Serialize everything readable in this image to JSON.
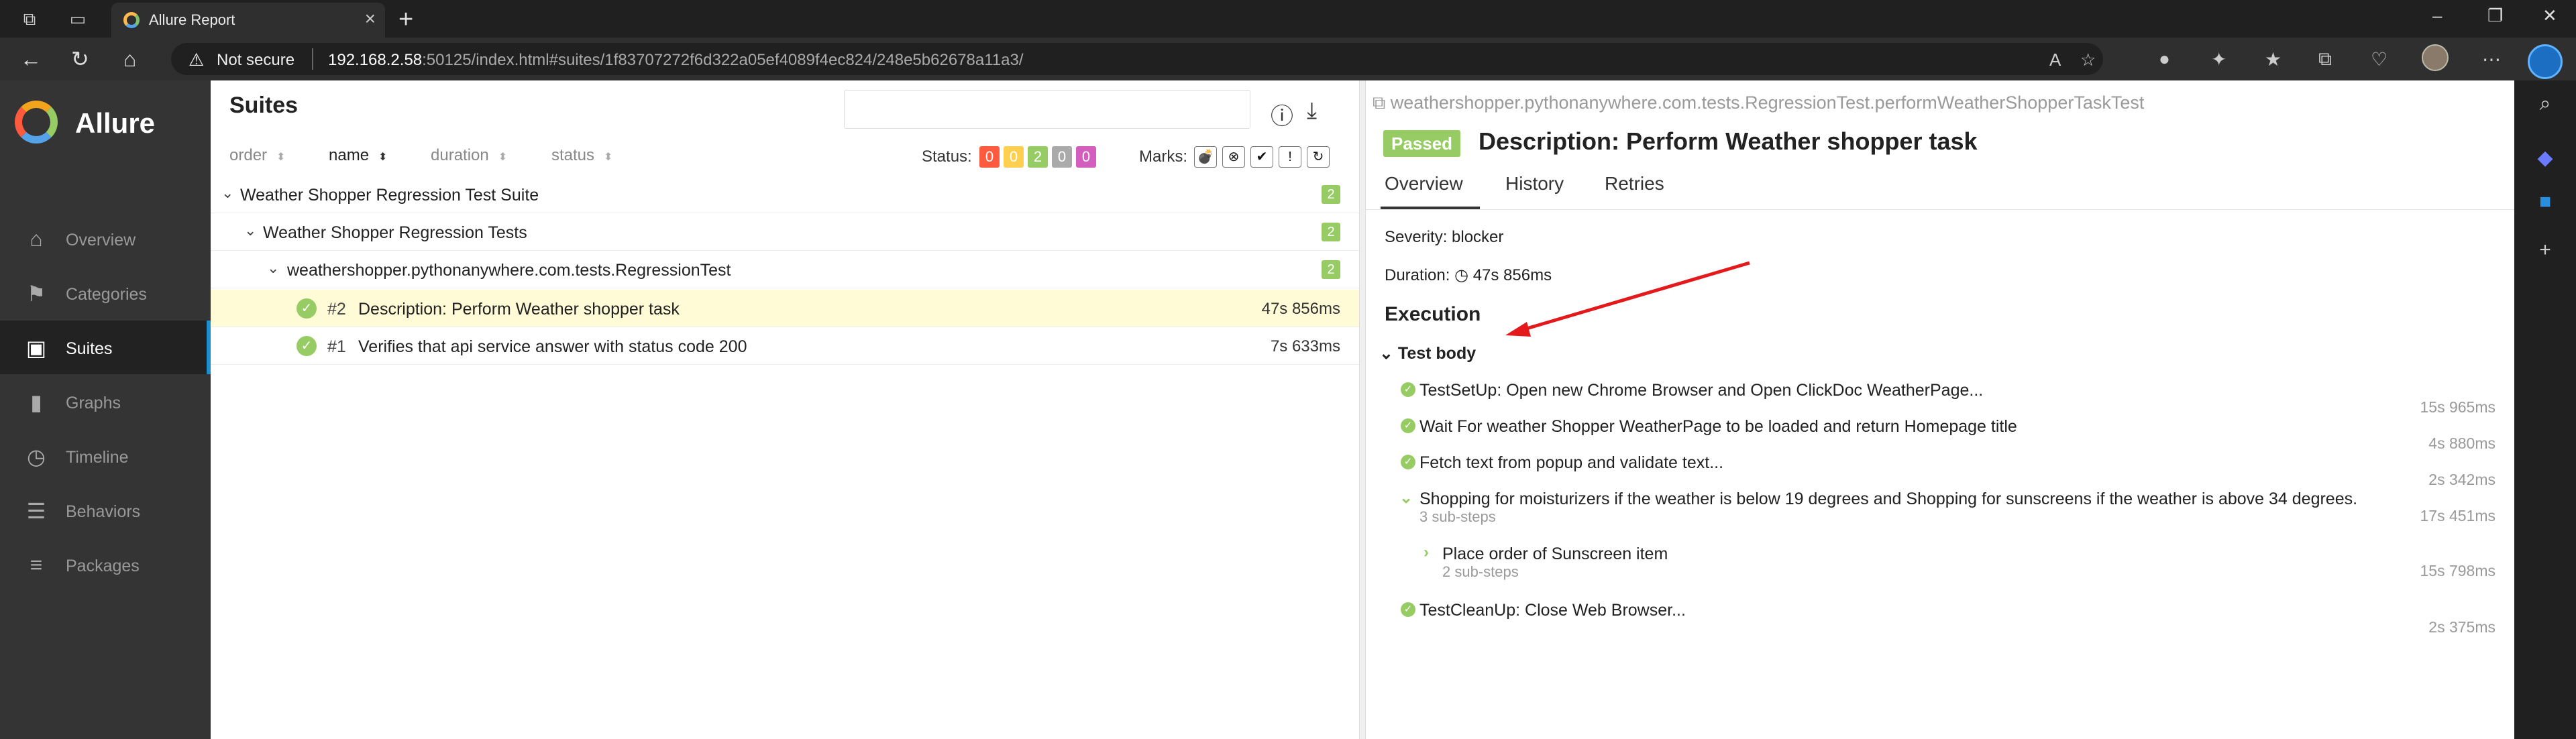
{
  "browser": {
    "tab_title": "Allure Report",
    "security_label": "Not secure",
    "url_host": "192.168.2.58",
    "url_rest": ":50125/index.html#suites/1f83707272f6d322a05ef4089f4ec824/248e5b62678a11a3/"
  },
  "sidebar": {
    "brand": "Allure",
    "items": [
      {
        "label": "Overview",
        "icon": "home-icon"
      },
      {
        "label": "Categories",
        "icon": "flag-icon"
      },
      {
        "label": "Suites",
        "icon": "briefcase-icon"
      },
      {
        "label": "Graphs",
        "icon": "bar-chart-icon"
      },
      {
        "label": "Timeline",
        "icon": "clock-icon"
      },
      {
        "label": "Behaviors",
        "icon": "list-icon"
      },
      {
        "label": "Packages",
        "icon": "align-left-icon"
      }
    ],
    "active": "Suites"
  },
  "suites": {
    "title": "Suites",
    "sort": [
      "order",
      "name",
      "duration",
      "status"
    ],
    "status_label": "Status:",
    "status_counts": [
      {
        "value": "0",
        "color": "#fd5a3e"
      },
      {
        "value": "0",
        "color": "#ffd050"
      },
      {
        "value": "2",
        "color": "#97cc64"
      },
      {
        "value": "0",
        "color": "#aaaaaa"
      },
      {
        "value": "0",
        "color": "#d35ebe"
      }
    ],
    "marks_label": "Marks:",
    "tree": [
      {
        "label": "Weather Shopper Regression Test Suite",
        "count": "2"
      },
      {
        "label": "Weather Shopper Regression Tests",
        "count": "2"
      },
      {
        "label": "weathershopper.pythonanywhere.com.tests.RegressionTest",
        "count": "2"
      }
    ],
    "tests": [
      {
        "num": "#2",
        "label": "Description: Perform Weather shopper task",
        "duration": "47s 856ms"
      },
      {
        "num": "#1",
        "label": "Verifies that api service answer with status code 200",
        "duration": "7s 633ms"
      }
    ]
  },
  "detail": {
    "full_name": "weathershopper.pythonanywhere.com.tests.RegressionTest.performWeatherShopperTaskTest",
    "status": "Passed",
    "title": "Description: Perform Weather shopper task",
    "tabs": [
      "Overview",
      "History",
      "Retries"
    ],
    "severity": "Severity: blocker",
    "duration_label": "Duration:",
    "duration": "47s 856ms",
    "execution": "Execution",
    "test_body": "Test body",
    "steps": [
      {
        "label": "TestSetUp: Open new Chrome Browser and Open ClickDoc WeatherPage...",
        "duration": "15s 965ms"
      },
      {
        "label": "Wait For weather Shopper WeatherPage to be loaded and return Homepage title",
        "duration": "4s 880ms"
      },
      {
        "label": "Fetch text from popup and validate text...",
        "duration": "2s 342ms"
      },
      {
        "label": "Shopping for moisturizers if the weather is below 19 degrees and Shopping for sunscreens if the weather is above 34 degrees.",
        "sub": "3 sub-steps",
        "duration": "17s 451ms"
      },
      {
        "label": "Place order of Sunscreen item",
        "sub": "2 sub-steps",
        "duration": "15s 798ms"
      },
      {
        "label": "TestCleanUp: Close Web Browser...",
        "duration": "2s 375ms"
      }
    ]
  }
}
